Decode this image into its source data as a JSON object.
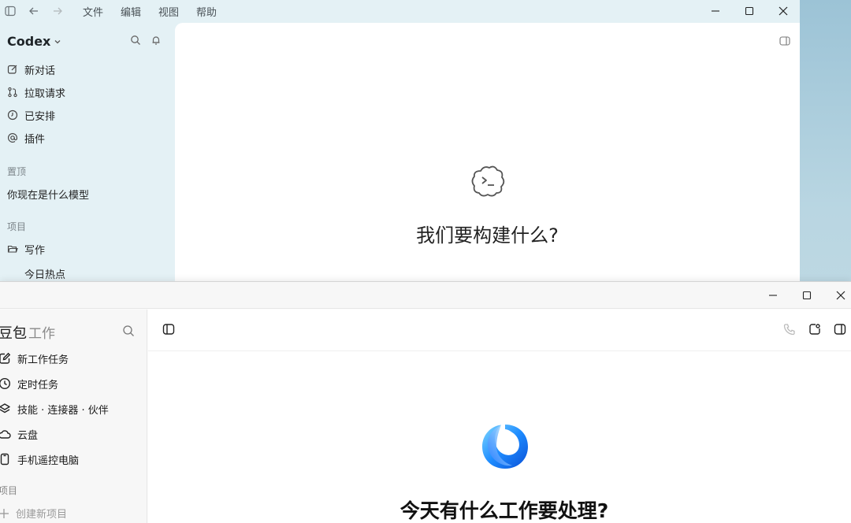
{
  "codex": {
    "menu": [
      "文件",
      "编辑",
      "视图",
      "帮助"
    ],
    "brand": "Codex",
    "nav": [
      {
        "label": "新对话",
        "icon": "edit-icon"
      },
      {
        "label": "拉取请求",
        "icon": "pull-request-icon"
      },
      {
        "label": "已安排",
        "icon": "clock-icon"
      },
      {
        "label": "插件",
        "icon": "at-icon"
      }
    ],
    "pinned_label": "置顶",
    "pinned_item": "你现在是什么模型",
    "projects_label": "项目",
    "project_folder": "写作",
    "project_sub_item": "今日热点",
    "hero_title": "我们要构建什么?"
  },
  "doubao": {
    "brand": "豆包",
    "brand_sub": "工作",
    "nav": [
      {
        "label": "新工作任务",
        "icon": "edit-icon"
      },
      {
        "label": "定时任务",
        "icon": "clock-icon"
      },
      {
        "label": "技能 · 连接器 · 伙伴",
        "icon": "layers-icon"
      },
      {
        "label": "云盘",
        "icon": "cloud-icon"
      },
      {
        "label": "手机遥控电脑",
        "icon": "phone-icon"
      }
    ],
    "projects_label": "项目",
    "create_project": "创建新项目",
    "hero_title": "今天有什么工作要处理?"
  }
}
